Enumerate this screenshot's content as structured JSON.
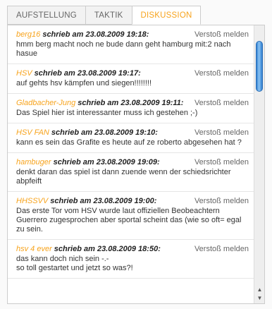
{
  "tabs": [
    {
      "label": "AUFSTELLUNG",
      "active": false
    },
    {
      "label": "TAKTIK",
      "active": false
    },
    {
      "label": "DISKUSSION",
      "active": true
    }
  ],
  "report_label": "Verstoß melden",
  "comments": [
    {
      "author": "berg16",
      "meta": " schrieb am 23.08.2009 19:18:",
      "text": "hmm berg macht noch ne bude dann geht hamburg mit:2 nach hasue"
    },
    {
      "author": "HSV",
      "meta": " schrieb am 23.08.2009 19:17:",
      "text": "auf gehts hsv kämpfen und siegen!!!!!!!!"
    },
    {
      "author": "Gladbacher-Jung",
      "meta": " schrieb am 23.08.2009 19:11:",
      "text": "Das Spiel hier ist interessanter muss ich gestehen ;-)"
    },
    {
      "author": "HSV FAN",
      "meta": " schrieb am 23.08.2009 19:10:",
      "text": "kann es sein das Grafite es heute auf ze roberto abgesehen hat ?"
    },
    {
      "author": "hambuger",
      "meta": " schrieb am 23.08.2009 19:09:",
      "text": "denkt daran das spiel ist dann zuende wenn der schiedsrichter abpfeift"
    },
    {
      "author": "HHSSVV",
      "meta": " schrieb am 23.08.2009 19:00:",
      "text": "Das erste Tor vom HSV wurde laut offiziellen Beobeachtern Guerrero zugesprochen aber sportal scheint das (wie so oft= egal zu sein."
    },
    {
      "author": "hsv 4 ever",
      "meta": " schrieb am 23.08.2009 18:50:",
      "text": "das kann doch nich sein -.-\nso toll gestartet und jetzt so was?!"
    }
  ],
  "scrollbar": {
    "up_icon": "up-arrow-icon",
    "down_icon": "down-arrow-icon",
    "thumb_color": "#2f7fd0"
  },
  "colors": {
    "accent": "#f7a31c",
    "border": "#cccccc",
    "text": "#333333"
  }
}
